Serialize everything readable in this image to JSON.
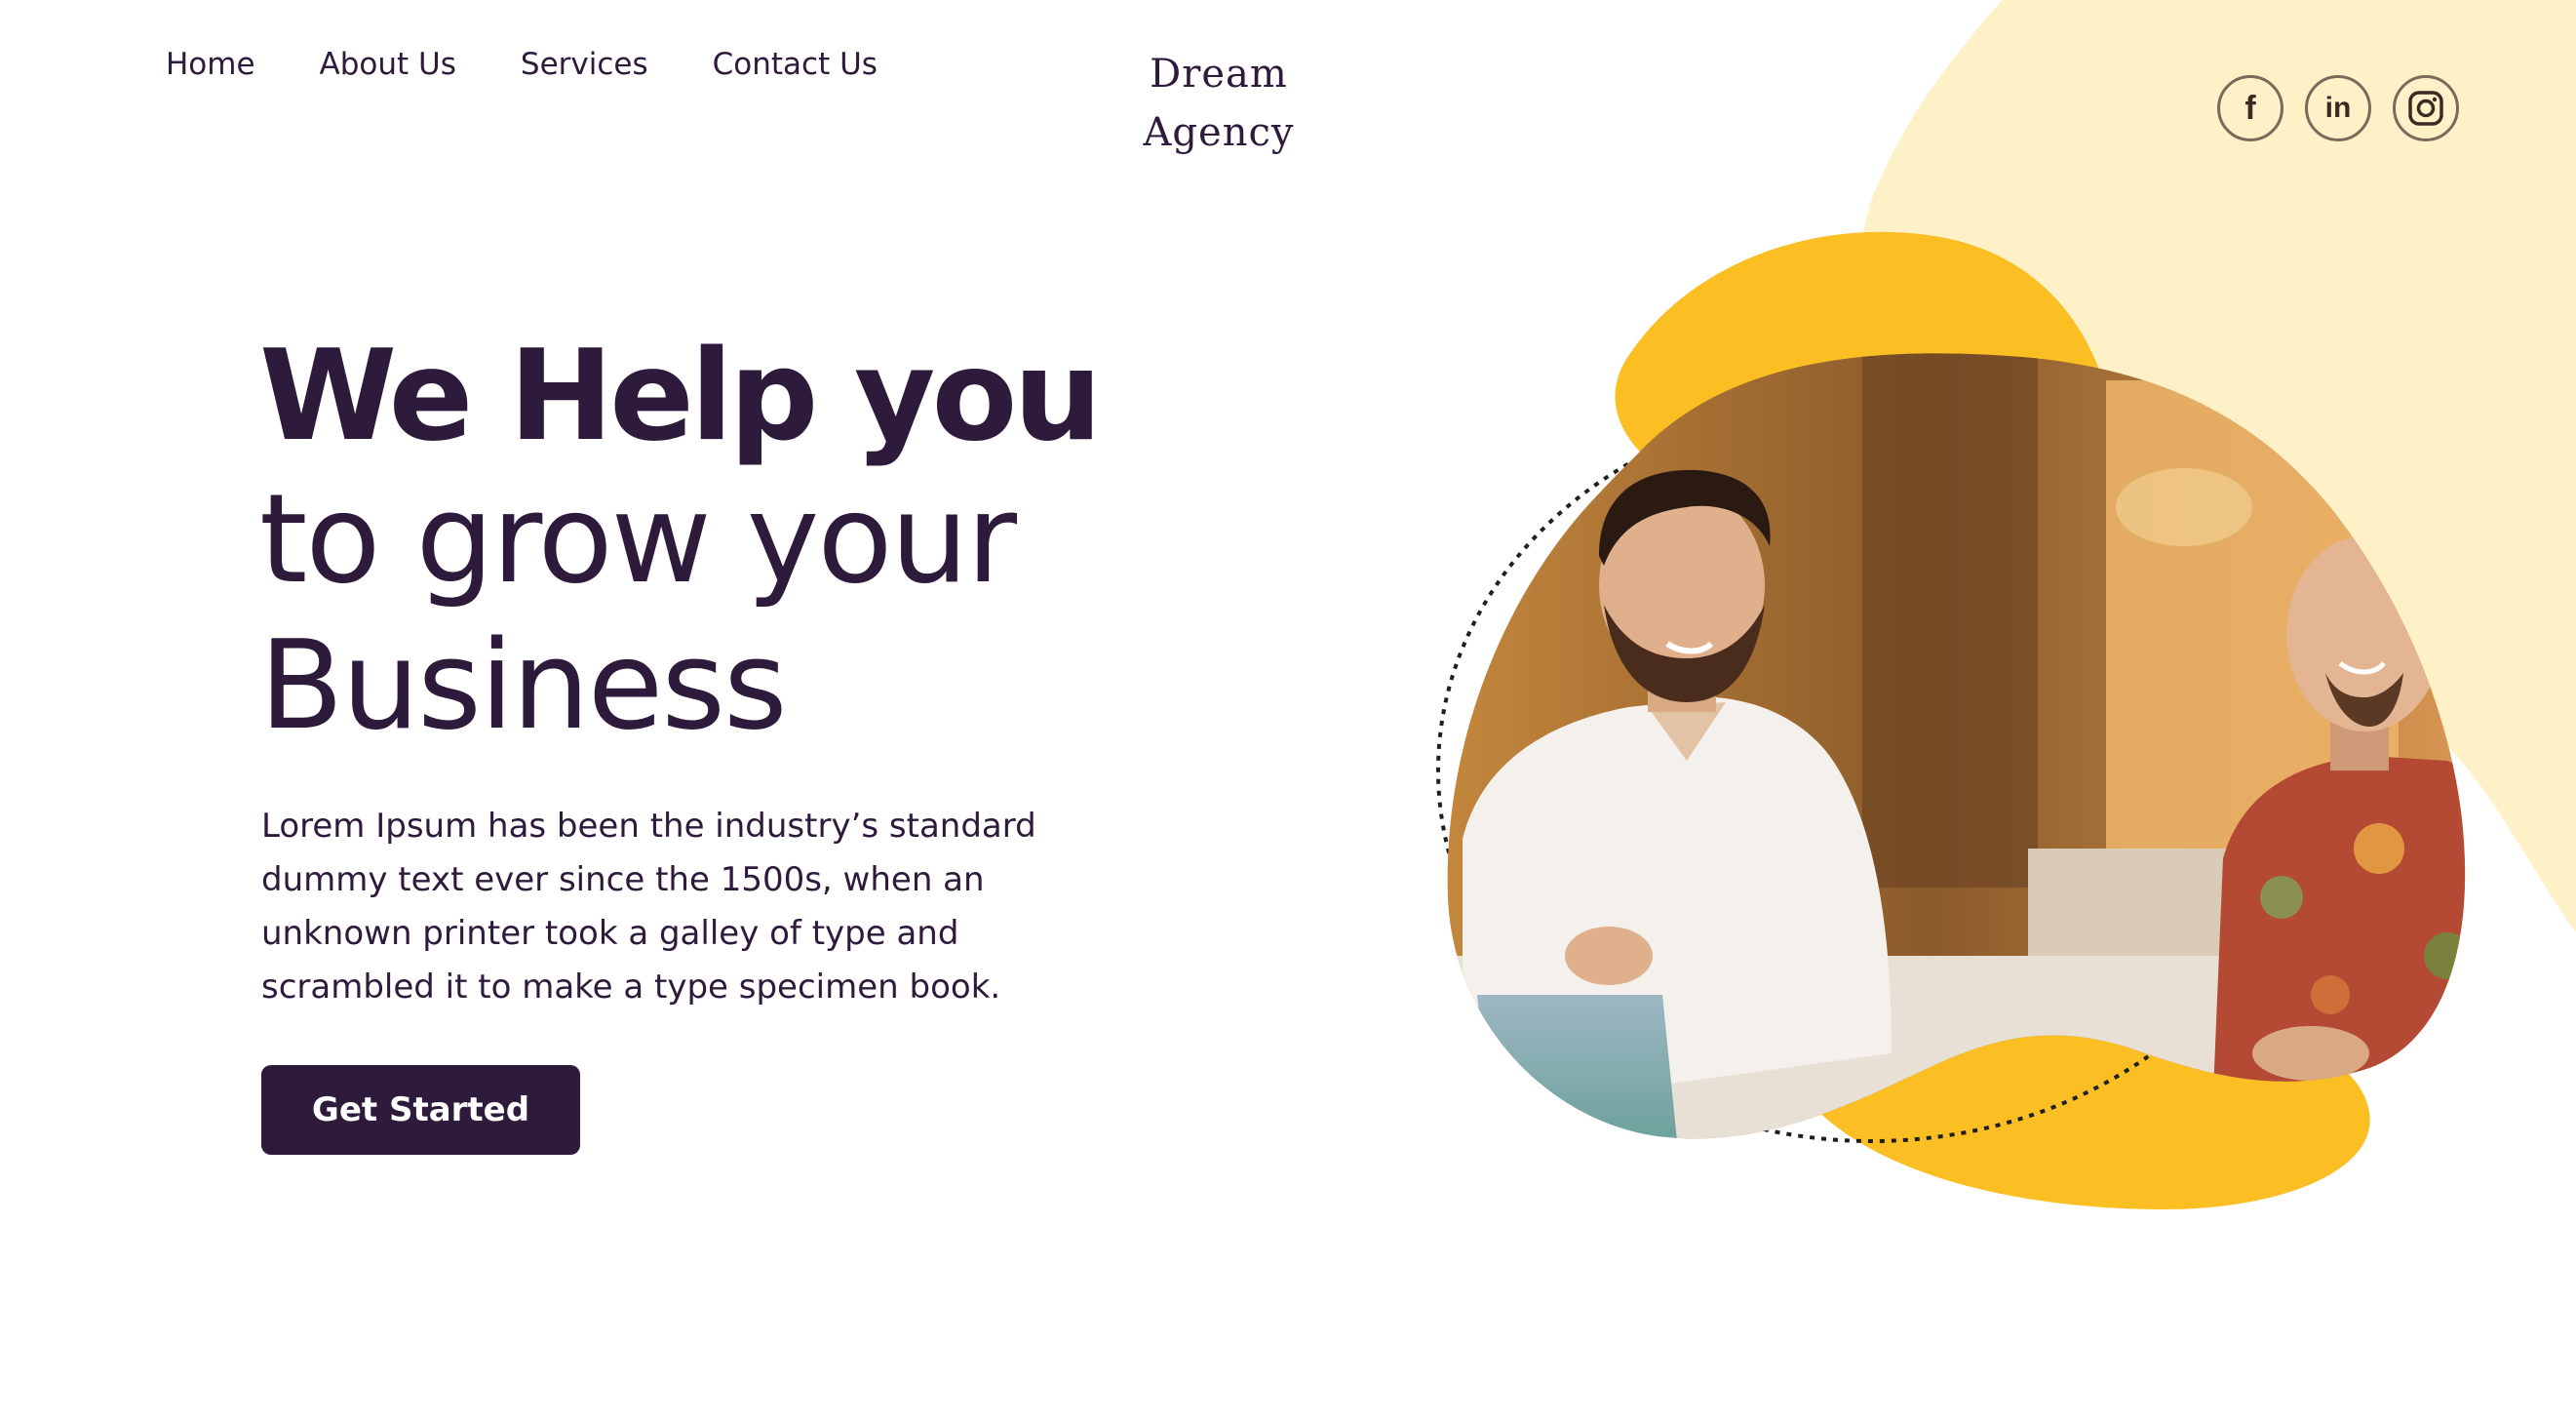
{
  "nav": {
    "items": [
      {
        "label": "Home"
      },
      {
        "label": "About Us"
      },
      {
        "label": "Services"
      },
      {
        "label": "Contact Us"
      }
    ]
  },
  "logo": {
    "line1": "Dream",
    "line2": "Agency"
  },
  "social": {
    "facebook_glyph": "f",
    "linkedin_glyph": "in",
    "icons": [
      "facebook-icon",
      "linkedin-icon",
      "instagram-icon"
    ]
  },
  "hero": {
    "line1": "We Help you",
    "line2": "to grow your",
    "line3": "Business",
    "description": "Lorem Ipsum has been the industry’s standard dummy text ever since the 1500s, when an unknown printer took a galley of type and scrambled it to make a type specimen book.",
    "cta_label": "Get Started"
  },
  "colors": {
    "primary": "#2e1a3b",
    "accent_yellow": "#fbbf24",
    "pale_yellow": "#fff1c7",
    "background": "#ffffff"
  }
}
